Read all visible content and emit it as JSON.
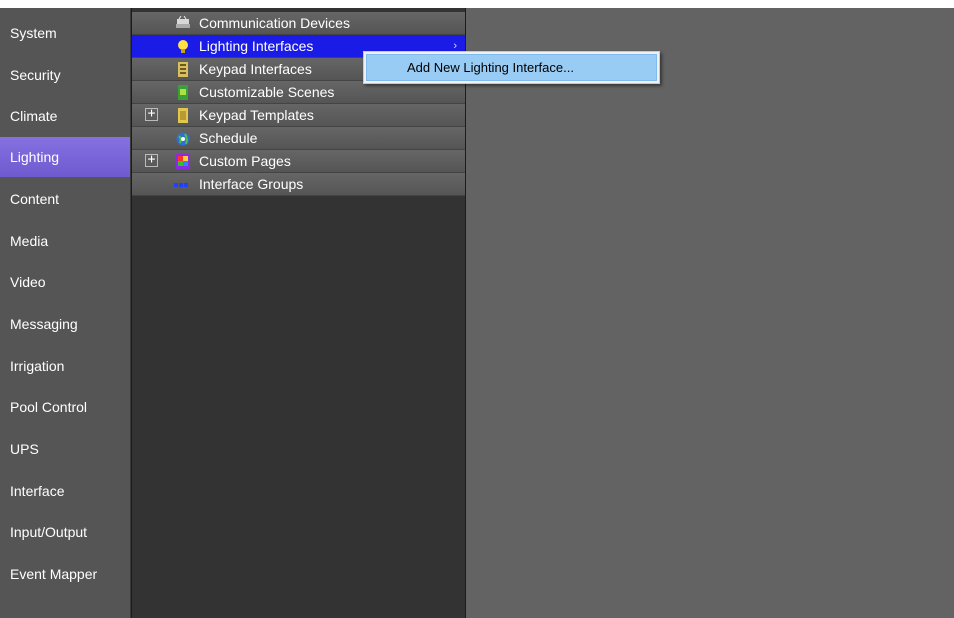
{
  "sidebar": {
    "items": [
      {
        "label": "System"
      },
      {
        "label": "Security"
      },
      {
        "label": "Climate"
      },
      {
        "label": "Lighting",
        "selected": true
      },
      {
        "label": "Content"
      },
      {
        "label": "Media"
      },
      {
        "label": "Video"
      },
      {
        "label": "Messaging"
      },
      {
        "label": "Irrigation"
      },
      {
        "label": "Pool Control"
      },
      {
        "label": "UPS"
      },
      {
        "label": "Interface"
      },
      {
        "label": "Input/Output"
      },
      {
        "label": "Event Mapper"
      }
    ]
  },
  "tree": {
    "items": [
      {
        "label": "Communication Devices",
        "icon": "communication-devices-icon"
      },
      {
        "label": "Lighting Interfaces",
        "icon": "lightbulb-icon",
        "selected": true,
        "submenu_arrow": "›"
      },
      {
        "label": "Keypad Interfaces",
        "icon": "keypad-icon"
      },
      {
        "label": "Customizable Scenes",
        "icon": "scene-icon"
      },
      {
        "label": "Keypad Templates",
        "icon": "keypad-template-icon",
        "expander": "+"
      },
      {
        "label": "Schedule",
        "icon": "globe-clock-icon"
      },
      {
        "label": "Custom Pages",
        "icon": "custom-pages-icon",
        "expander": "+"
      },
      {
        "label": "Interface Groups",
        "icon": "interface-groups-icon"
      }
    ]
  },
  "context_menu": {
    "items": [
      {
        "label": "Add New Lighting Interface..."
      }
    ]
  },
  "colors": {
    "sidebar_bg": "#555555",
    "sidebar_selected": "#7c6ad8",
    "tree_bg": "#333333",
    "tree_row": "#5e5e5e",
    "tree_selected": "#1b1be8",
    "content_bg": "#636363",
    "menu_highlight": "#99ccf5"
  }
}
